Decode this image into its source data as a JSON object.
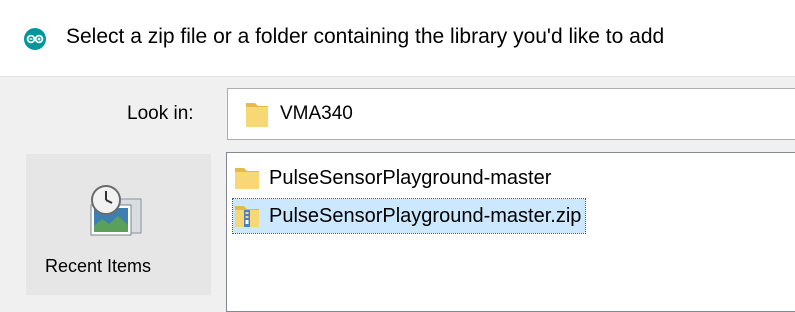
{
  "dialog": {
    "title": "Select a zip file or a folder containing the library you'd like to add",
    "title_icon": "arduino-icon"
  },
  "lookin": {
    "label": "Look in:",
    "value": "VMA340",
    "icon": "folder-icon"
  },
  "places": {
    "items": [
      {
        "label": "Recent Items",
        "icon": "recent-items-icon"
      }
    ]
  },
  "files": {
    "items": [
      {
        "name": "PulseSensorPlayground-master",
        "icon": "folder-icon",
        "selected": false
      },
      {
        "name": "PulseSensorPlayground-master.zip",
        "icon": "zip-folder-icon",
        "selected": true
      }
    ]
  },
  "colors": {
    "selection": "#cce8ff",
    "folder": "#f8d775",
    "arduino": "#00979c"
  }
}
